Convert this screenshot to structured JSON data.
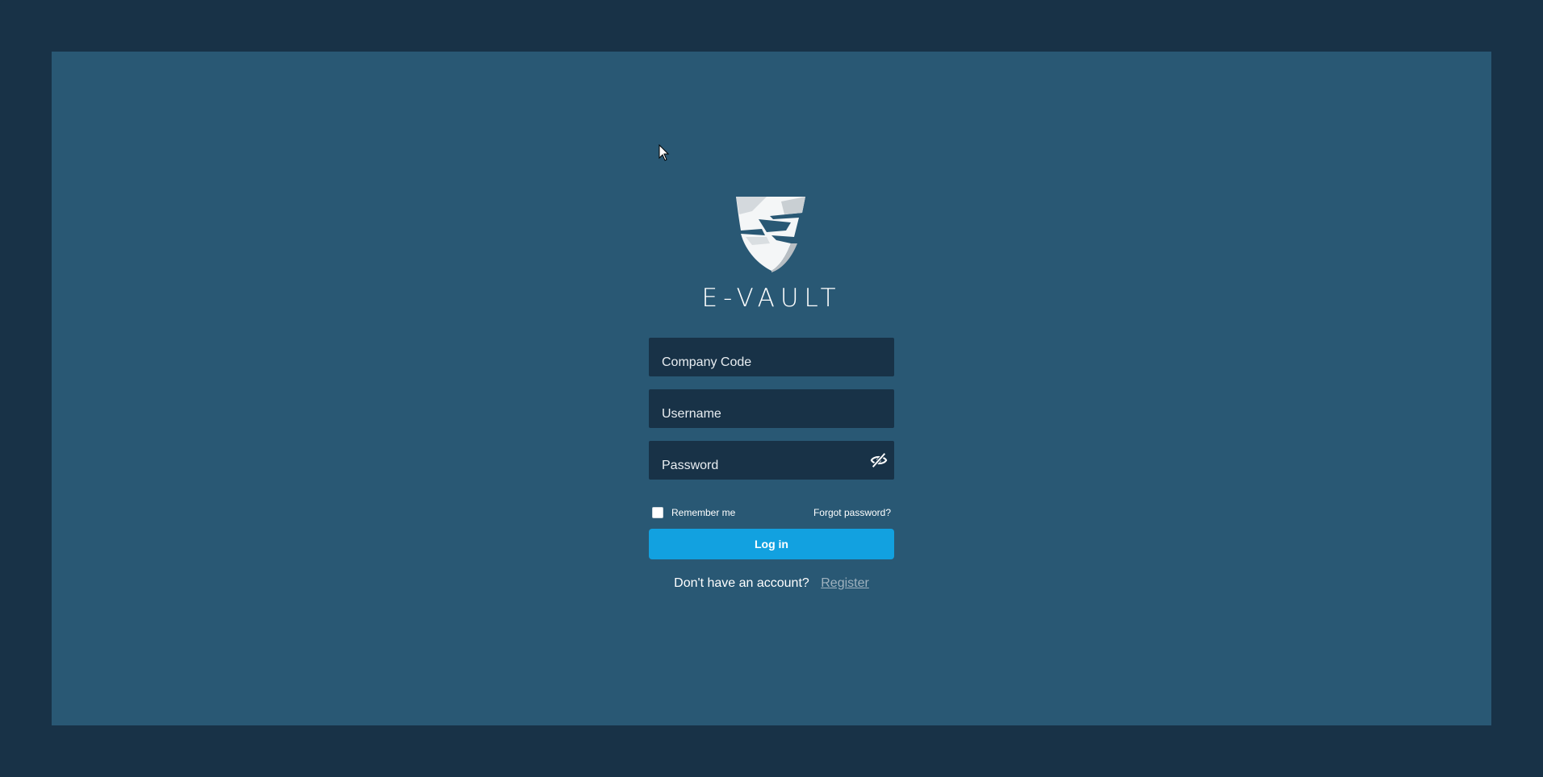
{
  "brand": {
    "name": "E-VAULT",
    "logo_icon": "shield-e-logo"
  },
  "form": {
    "company_code": {
      "placeholder": "Company Code",
      "value": ""
    },
    "username": {
      "placeholder": "Username",
      "value": ""
    },
    "password": {
      "placeholder": "Password",
      "value": "",
      "toggle_icon": "eye-slash-icon"
    },
    "remember_label": "Remember me",
    "remember_checked": false,
    "forgot_label": "Forgot password?",
    "login_label": "Log in"
  },
  "signup": {
    "prompt": "Don't have an account?",
    "link_label": "Register"
  },
  "colors": {
    "outer_bg": "#183247",
    "panel_bg": "#295874",
    "field_bg": "#183247",
    "accent": "#12a1e0",
    "link_muted": "#9fb2bf"
  }
}
